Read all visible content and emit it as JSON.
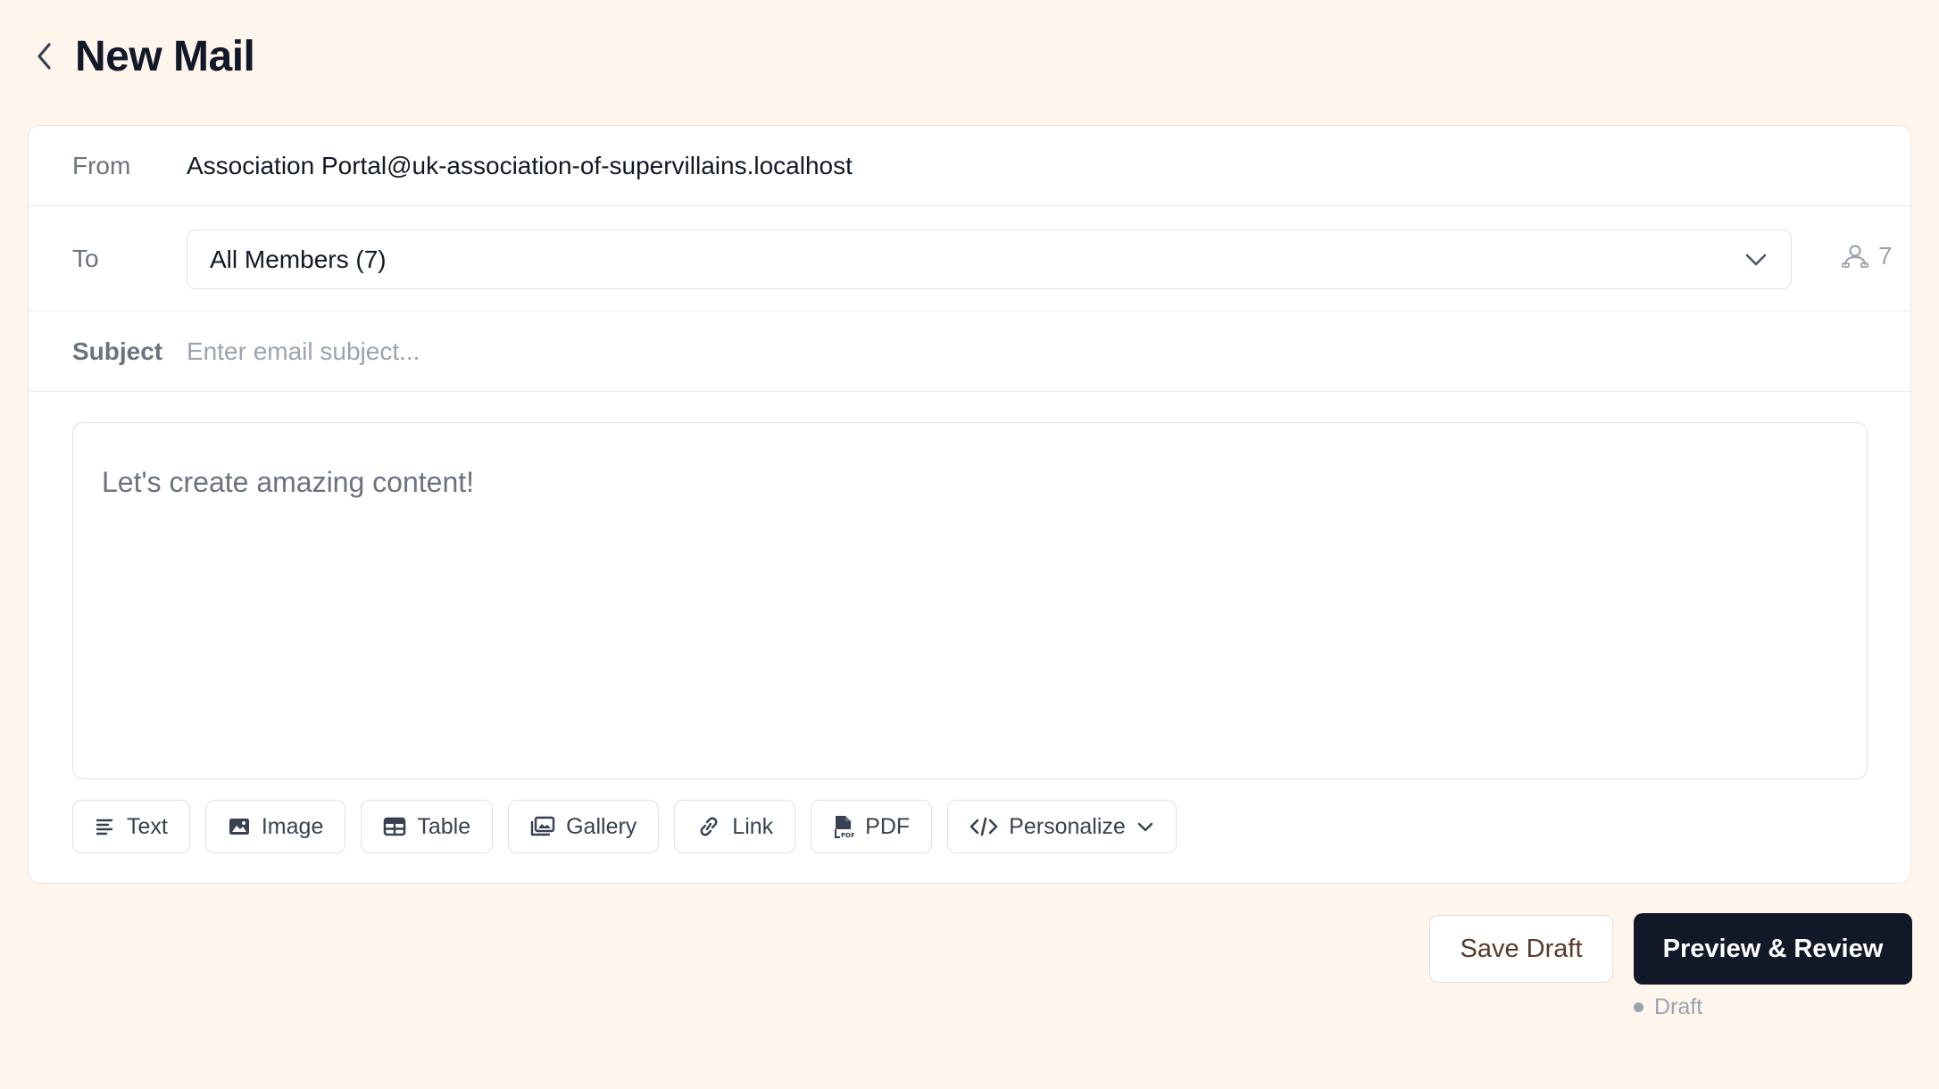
{
  "header": {
    "title": "New Mail",
    "back_icon": "chevron-left-icon"
  },
  "compose": {
    "from": {
      "label": "From",
      "value": "Association Portal@uk-association-of-supervillains.localhost"
    },
    "to": {
      "label": "To",
      "selected": "All Members (7)",
      "recipient_count": "7",
      "count_icon": "users-icon"
    },
    "subject": {
      "label": "Subject",
      "value": "",
      "placeholder": "Enter email subject..."
    },
    "editor": {
      "placeholder": "Let's create amazing content!"
    }
  },
  "toolbar": {
    "items": [
      {
        "label": "Text",
        "icon": "text-align-left-icon"
      },
      {
        "label": "Image",
        "icon": "image-icon"
      },
      {
        "label": "Table",
        "icon": "table-icon"
      },
      {
        "label": "Gallery",
        "icon": "gallery-icon"
      },
      {
        "label": "Link",
        "icon": "link-icon"
      },
      {
        "label": "PDF",
        "icon": "pdf-file-icon"
      },
      {
        "label": "Personalize",
        "icon": "code-icon",
        "has_dropdown": true
      }
    ]
  },
  "actions": {
    "save_label": "Save Draft",
    "preview_label": "Preview & Review"
  },
  "status": {
    "text": "Draft"
  },
  "colors": {
    "background": "#fff5ec",
    "primary_button": "#111827",
    "muted_text": "#9ca3af"
  }
}
